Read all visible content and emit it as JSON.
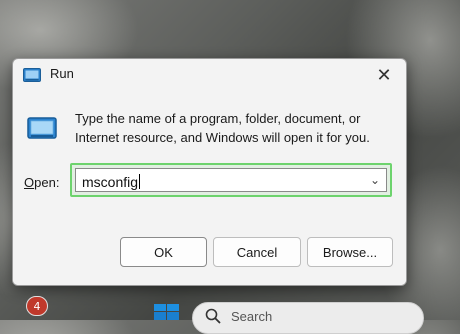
{
  "dialog": {
    "title": "Run",
    "close_glyph": "✕",
    "title_icon": "run-icon",
    "description": "Type the name of a program, folder, document, or Internet resource, and Windows will open it for you.",
    "open_label_prefix": "",
    "open_label_underlined": "O",
    "open_label_rest": "pen:",
    "open_value": "msconfig",
    "dropdown_glyph": "⌄",
    "buttons": {
      "ok": "OK",
      "cancel": "Cancel",
      "browse": "Browse..."
    },
    "highlight_color": "#6dd36d"
  },
  "taskbar": {
    "notification_count": "4",
    "search_text": "Search"
  }
}
